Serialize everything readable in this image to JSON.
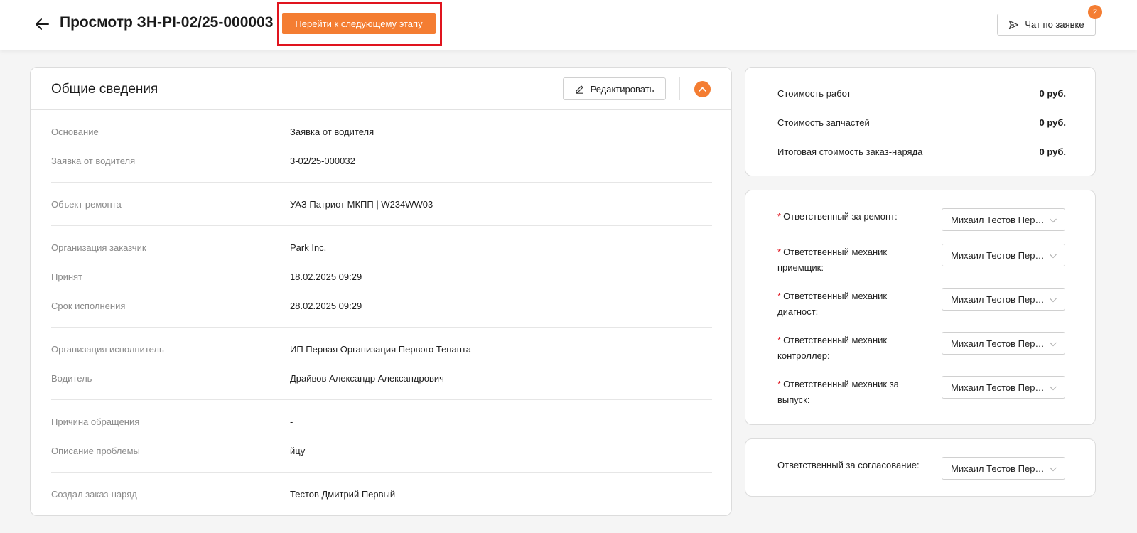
{
  "header": {
    "title": "Просмотр ЗН-PI-02/25-000003",
    "next_stage_label": "Перейти к следующему этапу",
    "chat_label": "Чат по заявке",
    "chat_badge": "2"
  },
  "general": {
    "title": "Общие сведения",
    "edit_label": "Редактировать",
    "groups": [
      [
        {
          "label": "Основание",
          "value": "Заявка от водителя"
        },
        {
          "label": "Заявка от водителя",
          "value": "3-02/25-000032"
        }
      ],
      [
        {
          "label": "Объект ремонта",
          "value": "УАЗ Патриот МКПП | W234WW03"
        }
      ],
      [
        {
          "label": "Организация заказчик",
          "value": "Park Inc."
        },
        {
          "label": "Принят",
          "value": "18.02.2025 09:29"
        },
        {
          "label": "Срок исполнения",
          "value": "28.02.2025 09:29"
        }
      ],
      [
        {
          "label": "Организация исполнитель",
          "value": "ИП Первая Организация Первого Тенанта"
        },
        {
          "label": "Водитель",
          "value": "Драйвов Александр Александрович"
        }
      ],
      [
        {
          "label": "Причина обращения",
          "value": "-"
        },
        {
          "label": "Описание проблемы",
          "value": "йцу"
        }
      ],
      [
        {
          "label": "Создал заказ-наряд",
          "value": "Тестов Дмитрий Первый"
        }
      ]
    ]
  },
  "costs": [
    {
      "label": "Стоимость работ",
      "value": "0 руб."
    },
    {
      "label": "Стоимость запчастей",
      "value": "0 руб."
    },
    {
      "label": "Итоговая стоимость заказ-наряда",
      "value": "0 руб."
    }
  ],
  "responsibles": [
    {
      "label": "Ответственный за ремонт:",
      "value": "Михаил Тестов Первый",
      "required": true
    },
    {
      "label": "Ответственный механик приемщик:",
      "value": "Михаил Тестов Первый",
      "required": true
    },
    {
      "label": "Ответственный механик диагност:",
      "value": "Михаил Тестов Первый",
      "required": true
    },
    {
      "label": "Ответственный механик контроллер:",
      "value": "Михаил Тестов Первый",
      "required": true
    },
    {
      "label": "Ответственный механик за выпуск:",
      "value": "Михаил Тестов Первый",
      "required": true
    }
  ],
  "approval": {
    "label": "Ответственный за согласование:",
    "value": "Михаил Тестов Первый"
  },
  "colors": {
    "accent": "#f47d32",
    "highlight": "#e0141e",
    "required": "#e0141e"
  },
  "icons": {
    "back": "arrow-left-icon",
    "chat": "send-icon",
    "edit": "pencil-icon",
    "collapse": "chevron-up-icon",
    "select": "chevron-down-icon"
  }
}
